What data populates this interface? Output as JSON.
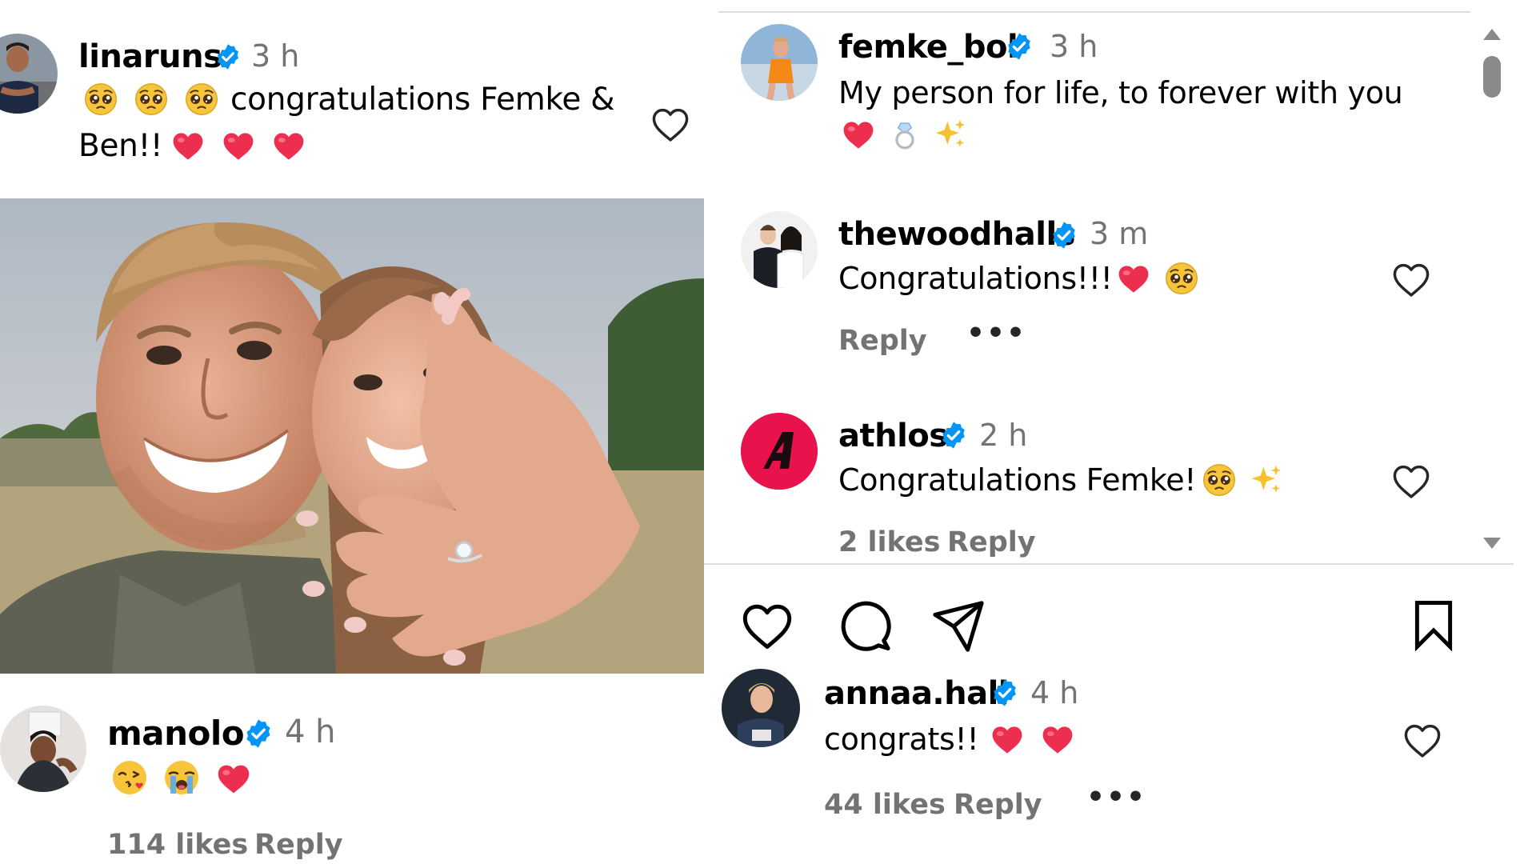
{
  "left_panel": {
    "top_comment": {
      "username": "linaruns",
      "time": "3 h",
      "text_line1": "congratulations Femke &",
      "text_line2": "Ben!!",
      "emojis_before": [
        "pleading-face",
        "pleading-face",
        "pleading-face"
      ],
      "emojis_after": [
        "red-heart",
        "red-heart",
        "red-heart"
      ]
    },
    "bottom_comment": {
      "username": "manolo",
      "time": "4 h",
      "emojis": [
        "face-blowing-kiss",
        "loudly-crying-face",
        "red-heart"
      ],
      "likes": "114 likes",
      "reply": "Reply"
    }
  },
  "right_panel": {
    "caption": {
      "username": "femke_bol",
      "time": "3 h",
      "text": "My person for life, to forever with you",
      "emojis": [
        "red-heart",
        "ring",
        "sparkles"
      ]
    },
    "comments": [
      {
        "username": "thewoodhalls",
        "time": "3 m",
        "text": "Congratulations!!!",
        "emojis": [
          "red-heart",
          "pleading-face"
        ],
        "reply": "Reply"
      },
      {
        "username": "athlos",
        "time": "2 h",
        "text": "Congratulations Femke!",
        "emojis": [
          "pleading-face",
          "sparkles"
        ],
        "likes": "2 likes",
        "reply": "Reply",
        "avatar_letter": "A"
      }
    ],
    "action_bar": {
      "icons": [
        "heart-icon",
        "comment-icon",
        "share-icon",
        "bookmark-icon"
      ]
    },
    "bottom_comment": {
      "username": "annaa.hall",
      "time": "4 h",
      "text": "congrats!!",
      "emojis": [
        "red-heart",
        "red-heart"
      ],
      "likes": "44 likes",
      "reply": "Reply"
    }
  },
  "colors": {
    "verified": "#0095f6",
    "heart": "#ed2f4f",
    "muted_text": "#737373",
    "athlos_brand": "#e8124d"
  }
}
